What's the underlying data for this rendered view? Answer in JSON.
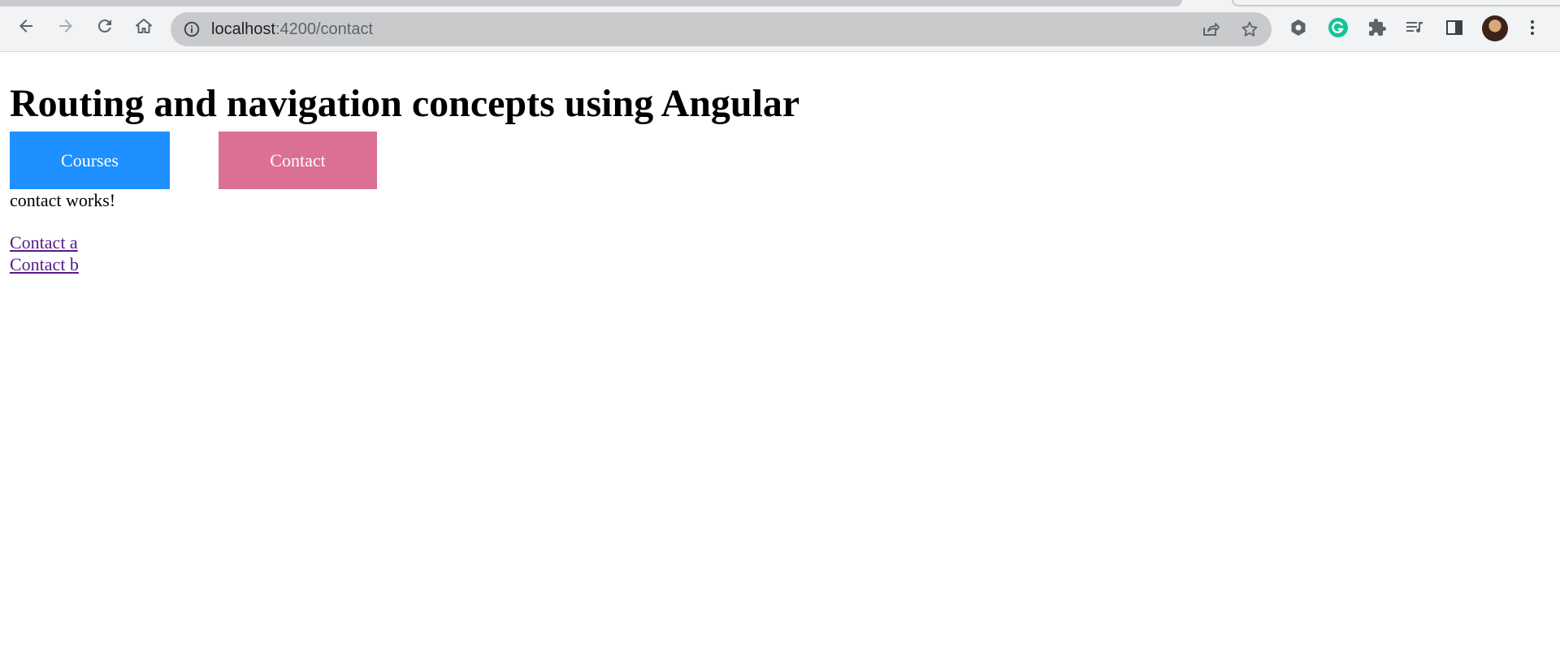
{
  "browser": {
    "url_host": "localhost",
    "url_path": ":4200/contact",
    "icons": {
      "back": "back-arrow-icon",
      "forward": "forward-arrow-icon",
      "reload": "reload-icon",
      "home": "home-icon",
      "site_info": "info-icon",
      "share": "share-icon",
      "bookmark": "star-icon",
      "extensions": [
        "hexagon-extension-icon",
        "grammarly-icon",
        "puzzle-icon",
        "media-queue-icon",
        "side-panel-icon"
      ],
      "menu": "kebab-menu-icon"
    },
    "colors": {
      "grammarly": "#15c39a"
    }
  },
  "page": {
    "title": "Routing and navigation concepts using Angular",
    "nav": {
      "courses_label": "Courses",
      "contact_label": "Contact",
      "courses_color": "#1e90ff",
      "contact_color": "#db7093"
    },
    "status_text": "contact works!",
    "links": [
      {
        "label": "Contact a"
      },
      {
        "label": "Contact b"
      }
    ]
  }
}
